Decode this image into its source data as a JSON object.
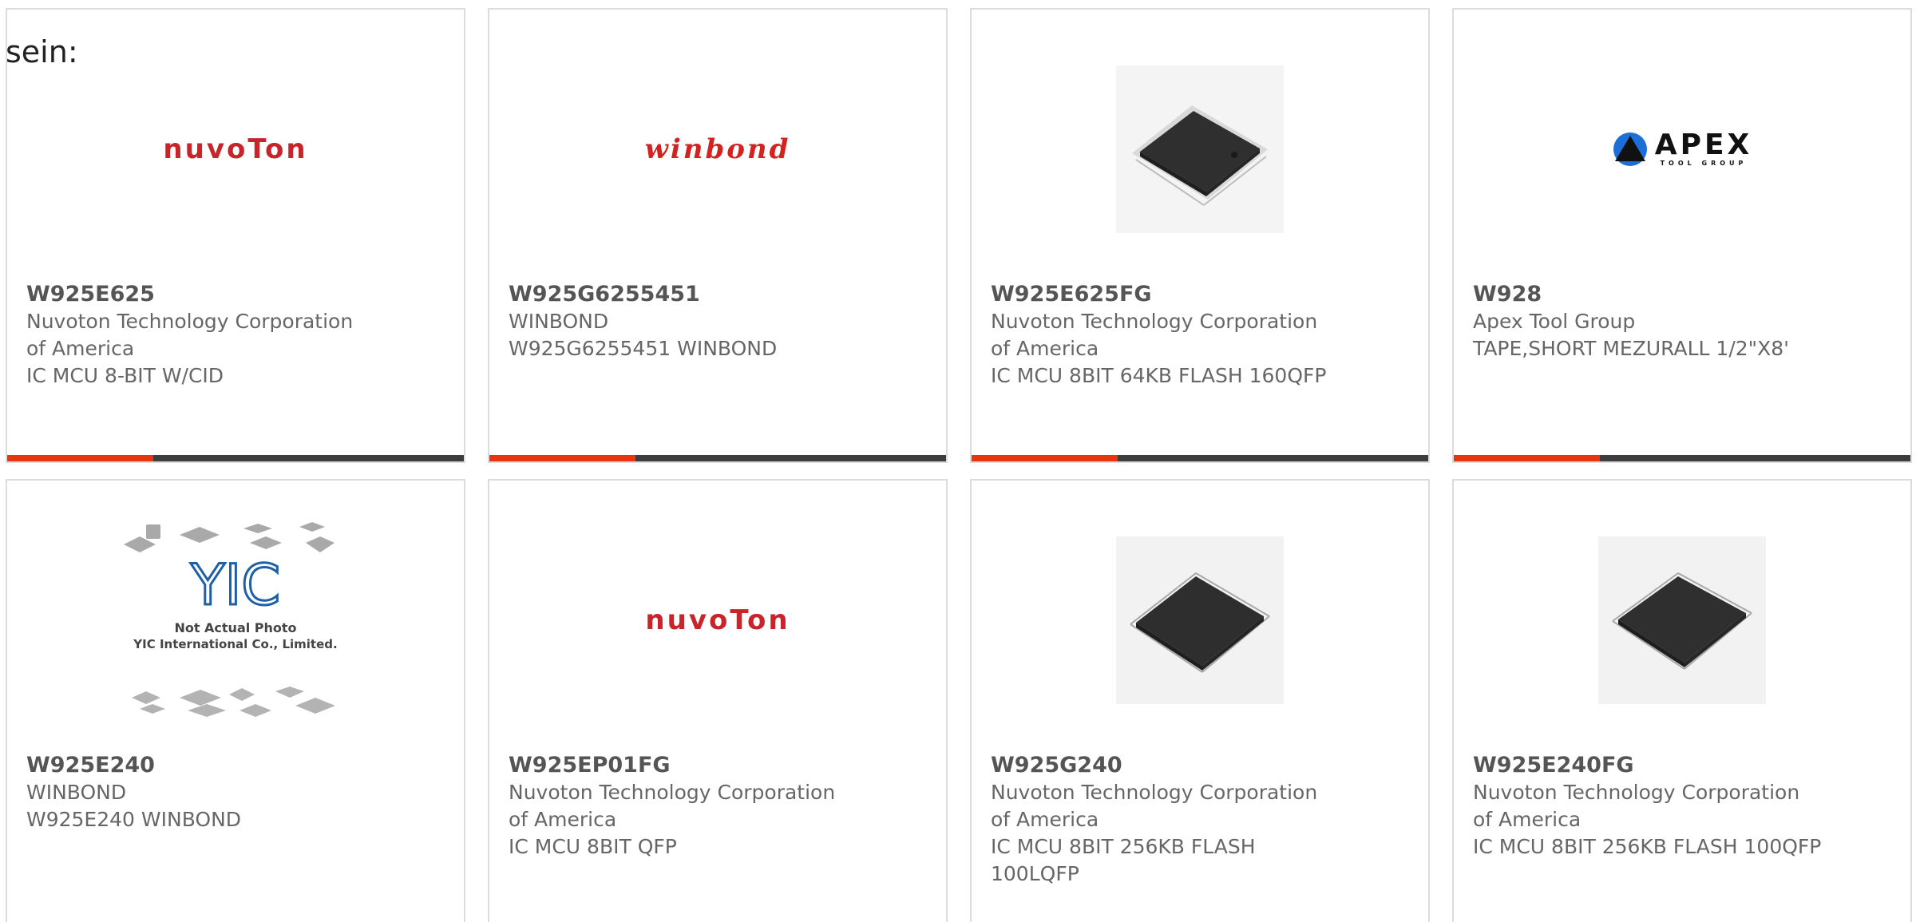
{
  "intro_text": "sein:",
  "products": [
    {
      "part_number": "W925E625",
      "manufacturer": "Nuvoton Technology Corporation of America",
      "description": "IC MCU 8-BIT W/CID",
      "image": "nuvoton-logo",
      "logo_text": "nuvoTon"
    },
    {
      "part_number": "W925G6255451",
      "manufacturer": "WINBOND",
      "description": "W925G6255451 WINBOND",
      "image": "winbond-logo",
      "logo_text": "winbond"
    },
    {
      "part_number": "W925E625FG",
      "manufacturer": "Nuvoton Technology Corporation of America",
      "description": "IC MCU 8BIT 64KB FLASH 160QFP",
      "image": "qfp-chip-photo"
    },
    {
      "part_number": "W928",
      "manufacturer": "Apex Tool Group",
      "description": "TAPE,SHORT MEZURALL 1/2\"X8'",
      "image": "apex-logo",
      "logo_text": "APEX",
      "logo_subtext": "TOOL GROUP"
    },
    {
      "part_number": "W925E240",
      "manufacturer": "WINBOND",
      "description": "W925E240 WINBOND",
      "image": "yic-placeholder",
      "placeholder_line1": "Not Actual Photo",
      "placeholder_line2": "YIC International Co., Limited.",
      "placeholder_logo": "YIC"
    },
    {
      "part_number": "W925EP01FG",
      "manufacturer": "Nuvoton Technology Corporation of America",
      "description": "IC MCU 8BIT QFP",
      "image": "nuvoton-logo",
      "logo_text": "nuvoTon"
    },
    {
      "part_number": "W925G240",
      "manufacturer": "Nuvoton Technology Corporation of America",
      "description": "IC MCU 8BIT 256KB FLASH 100LQFP",
      "image": "lqfp-chip-photo"
    },
    {
      "part_number": "W925E240FG",
      "manufacturer": "Nuvoton Technology Corporation of America",
      "description": "IC MCU 8BIT 256KB FLASH 100QFP",
      "image": "qfp-chip-photo"
    }
  ],
  "colors": {
    "accent": "#e8350f",
    "bar": "#3d3d3d",
    "nuvoton_red": "#c8242a",
    "winbond_red": "#d3221f",
    "yic_blue": "#1f5fa8"
  }
}
